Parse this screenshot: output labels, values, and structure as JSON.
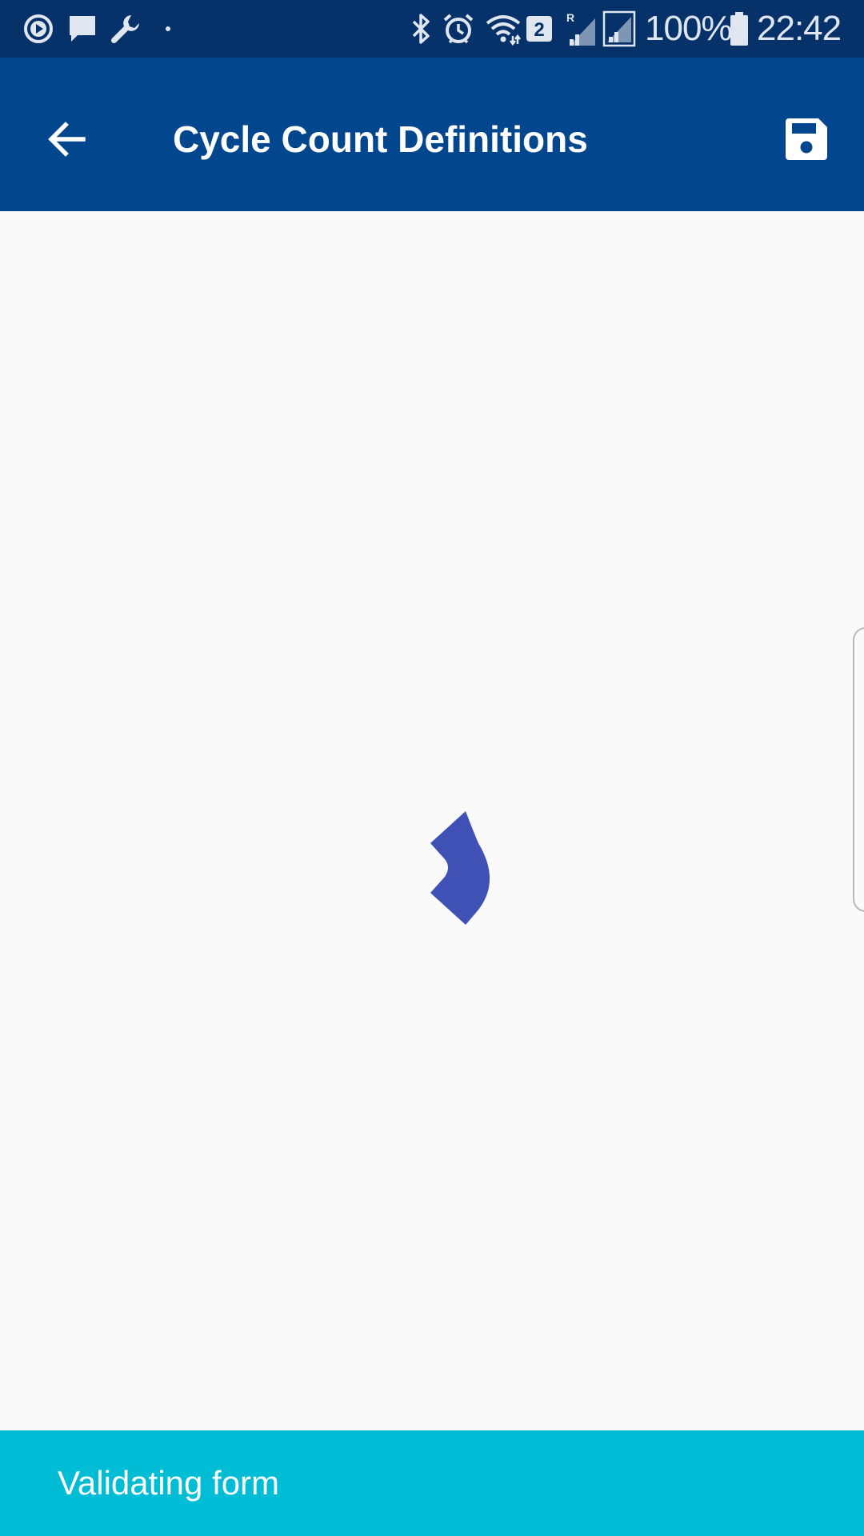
{
  "status_bar": {
    "battery_percent": "100%",
    "time": "22:42",
    "sim_badge": "2",
    "roaming_indicator": "R",
    "left_icons": [
      "play-circle-icon",
      "chat-bubble-icon",
      "wrench-icon",
      "dot-icon"
    ],
    "right_icons": [
      "bluetooth-icon",
      "alarm-icon",
      "wifi-icon",
      "sim-2-icon",
      "signal-roaming-icon",
      "signal-icon",
      "battery-icon"
    ]
  },
  "app_bar": {
    "title": "Cycle Count Definitions",
    "back_icon": "arrow-back-icon",
    "save_icon": "floppy-disk-icon",
    "background": "#02468d"
  },
  "content": {
    "loading_indicator": "spinner-icon",
    "spinner_color": "#3f51b5"
  },
  "snackbar": {
    "message": "Validating form",
    "background": "#00bcd4"
  },
  "colors": {
    "status_bar": "#063269",
    "app_bar": "#02468d",
    "accent": "#3f51b5",
    "snackbar": "#00bcd4",
    "page_background": "#fafafa"
  }
}
